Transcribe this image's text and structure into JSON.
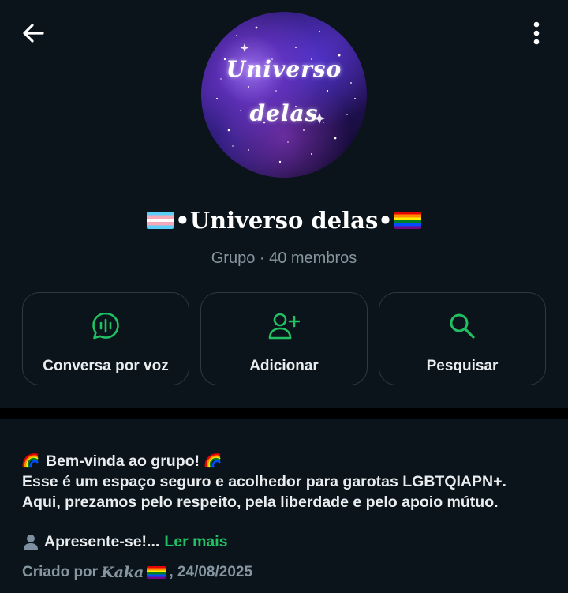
{
  "header": {
    "back_icon": "arrow-left-icon",
    "menu_icon": "more-vertical-icon"
  },
  "avatar": {
    "line1": "Universo",
    "line2": "delas"
  },
  "group": {
    "name": "•Universo delas•",
    "meta": "Grupo · 40 membros"
  },
  "actions": [
    {
      "label": "Conversa por voz",
      "icon": "voice-chat-icon"
    },
    {
      "label": "Adicionar",
      "icon": "add-person-icon"
    },
    {
      "label": "Pesquisar",
      "icon": "search-icon"
    }
  ],
  "description": {
    "line1": "Bem-vinda ao grupo!",
    "line2": "Esse é um espaço seguro e acolhedor para garotas LGBTQIAPN+.",
    "line3": "Aqui, prezamos pelo respeito, pela liberdade e pelo apoio mútuo.",
    "line4": "Apresente-se!...",
    "read_more": "Ler mais"
  },
  "created": {
    "prefix": "Criado por",
    "creator": "Kaka",
    "date": ", 24/08/2025"
  },
  "colors": {
    "background": "#0b141a",
    "accent_green": "#21c063",
    "secondary_text": "#8696a0",
    "card_border": "#2a3942"
  }
}
